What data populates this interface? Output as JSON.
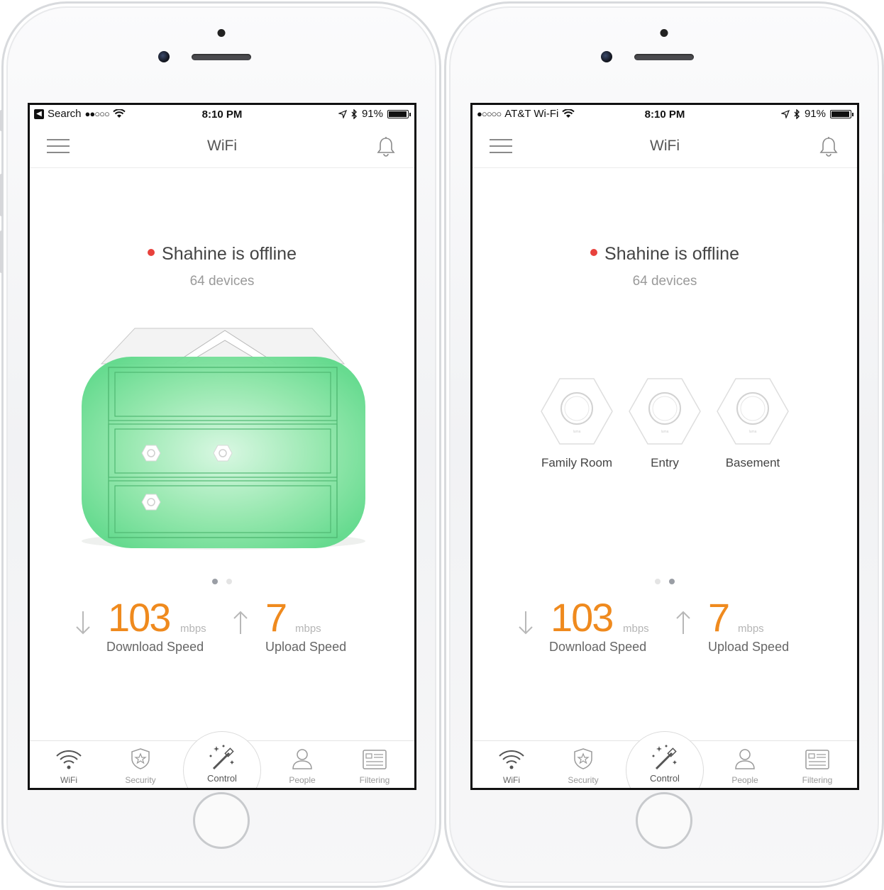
{
  "phones": [
    {
      "statusbar": {
        "back_label": "Search",
        "signal": "●●○○○",
        "time": "8:10 PM",
        "battery": "91%",
        "battery_level": 0.91
      },
      "navbar": {
        "title": "WiFi",
        "menu_icon": "hamburger-icon",
        "notification_icon": "bell-icon"
      },
      "network": {
        "status": "Shahine is offline",
        "status_color": "#e8413c",
        "devices": "64 devices"
      },
      "pager": {
        "pages": 2,
        "active": 0
      },
      "speeds": {
        "download": {
          "value": "103",
          "unit": "mbps",
          "label": "Download Speed"
        },
        "upload": {
          "value": "7",
          "unit": "mbps",
          "label": "Upload Speed"
        }
      },
      "tabs": [
        {
          "label": "WiFi",
          "icon": "wifi-icon"
        },
        {
          "label": "Security",
          "icon": "shield-star-icon"
        },
        {
          "label": "Control",
          "icon": "magic-wand-icon"
        },
        {
          "label": "People",
          "icon": "person-icon"
        },
        {
          "label": "Filtering",
          "icon": "filter-list-icon"
        }
      ]
    },
    {
      "statusbar": {
        "carrier": "AT&T Wi-Fi",
        "signal": "●○○○○",
        "time": "8:10 PM",
        "battery": "91%",
        "battery_level": 0.91
      },
      "navbar": {
        "title": "WiFi",
        "menu_icon": "hamburger-icon",
        "notification_icon": "bell-icon"
      },
      "network": {
        "status": "Shahine is offline",
        "status_color": "#e8413c",
        "devices": "64 devices"
      },
      "nodes": [
        {
          "label": "Family Room"
        },
        {
          "label": "Entry"
        },
        {
          "label": "Basement"
        }
      ],
      "pager": {
        "pages": 2,
        "active": 1
      },
      "speeds": {
        "download": {
          "value": "103",
          "unit": "mbps",
          "label": "Download Speed"
        },
        "upload": {
          "value": "7",
          "unit": "mbps",
          "label": "Upload Speed"
        }
      },
      "tabs": [
        {
          "label": "WiFi",
          "icon": "wifi-icon"
        },
        {
          "label": "Security",
          "icon": "shield-star-icon"
        },
        {
          "label": "Control",
          "icon": "magic-wand-icon"
        },
        {
          "label": "People",
          "icon": "person-icon"
        },
        {
          "label": "Filtering",
          "icon": "filter-list-icon"
        }
      ]
    }
  ],
  "colors": {
    "accent_orange": "#ef8a1e",
    "coverage_green": "#5fd98a",
    "offline_red": "#e8413c"
  }
}
